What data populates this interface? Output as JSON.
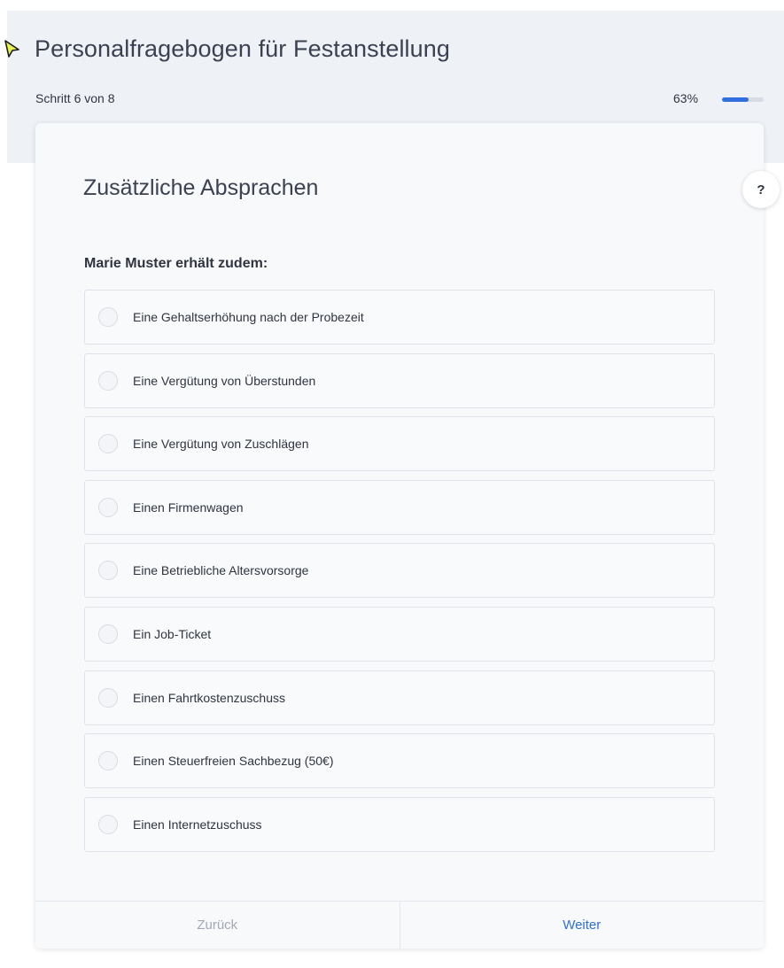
{
  "header": {
    "title": "Personalfragebogen für Festanstellung",
    "step": "Schritt 6 von 8",
    "progress_text": "63%",
    "progress_value": 0.63
  },
  "help": {
    "label": "?"
  },
  "section": {
    "title": "Zusätzliche Absprachen",
    "question": "Marie Muster erhält zudem:",
    "options": [
      "Eine Gehaltserhöhung nach der Probezeit",
      "Eine Vergütung von Überstunden",
      "Eine Vergütung von Zuschlägen",
      "Einen Firmenwagen",
      "Eine Betriebliche Altersvorsorge",
      "Ein Job-Ticket",
      "Einen Fahrtkostenzuschuss",
      "Einen Steuerfreien Sachbezug (50€)",
      "Einen Internetzuschuss"
    ]
  },
  "footer": {
    "back_label": "Zurück",
    "next_label": "Weiter"
  },
  "colors": {
    "accent": "#2f6fde",
    "header_bg": "#eef2f7",
    "card_bg": "#f8f9fb"
  },
  "icons": {
    "cursor": "cursor-arrow-icon",
    "help": "help-icon",
    "radio": "radio-unchecked-icon"
  }
}
